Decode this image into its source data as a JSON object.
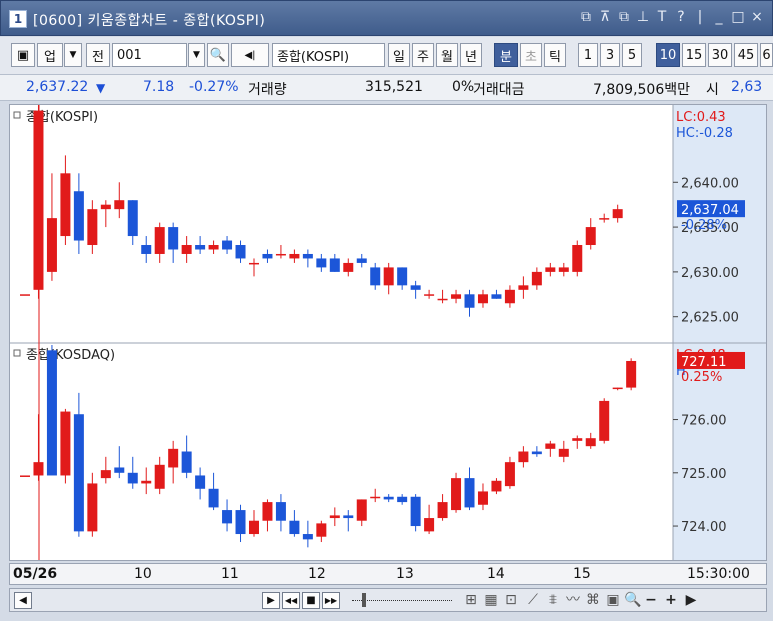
{
  "window": {
    "badge": "1",
    "title": "[0600] 키움종합차트 - 종합(KOSPI)",
    "controls": [
      "⧉",
      "⊼",
      "⧉",
      "⊥",
      "T",
      "?",
      "|",
      "_",
      "□",
      "×"
    ]
  },
  "toolbar": {
    "layout_icon": "▣",
    "market": "업",
    "prev": "전",
    "code": "001",
    "search_icon": "🔍",
    "sound_icon": "◀|",
    "stock_name": "종합(KOSPI)",
    "periods": [
      "일",
      "주",
      "월",
      "년",
      "분",
      "초",
      "틱"
    ],
    "active_period": "분",
    "intervals": [
      "1",
      "3",
      "5",
      "10",
      "15",
      "30",
      "45",
      "6"
    ],
    "active_interval": "10"
  },
  "quote": {
    "price": "2,637.22",
    "arrow": "▼",
    "change": "7.18",
    "change_pct": "-0.27%",
    "volume_label": "거래량",
    "volume": "315,521",
    "volume_pct": "0%",
    "turnover_label": "거래대금",
    "turnover": "7,809,506백만",
    "overflow_label": "시",
    "overflow_value": "2,63"
  },
  "chart_data": [
    {
      "type": "candlestick",
      "title": "종합(KOSPI)",
      "lc_label": "LC:0.43",
      "hc_label": "HC:-0.28",
      "y_ticks": [
        "2,640.00",
        "2,635.00",
        "2,630.00",
        "2,625.00"
      ],
      "y_tick_values": [
        2640,
        2635,
        2630,
        2625
      ],
      "ylim": [
        2622.4,
        2648.4
      ],
      "current_value": "2,637.04",
      "current_pct": "-0.28%",
      "candles": [
        {
          "o": 2627.5,
          "h": 2627.5,
          "l": 2627.5,
          "c": 2627.5
        },
        {
          "o": 2628.0,
          "h": 2649.0,
          "l": 2627.0,
          "c": 2648.0
        },
        {
          "o": 2630.0,
          "h": 2641.0,
          "l": 2629.0,
          "c": 2636.0
        },
        {
          "o": 2634.0,
          "h": 2643.0,
          "l": 2633.0,
          "c": 2641.0
        },
        {
          "o": 2639.0,
          "h": 2641.0,
          "l": 2632.0,
          "c": 2633.5
        },
        {
          "o": 2633.0,
          "h": 2638.0,
          "l": 2632.0,
          "c": 2637.0
        },
        {
          "o": 2637.0,
          "h": 2638.0,
          "l": 2635.0,
          "c": 2637.5
        },
        {
          "o": 2637.0,
          "h": 2640.0,
          "l": 2636.0,
          "c": 2638.0
        },
        {
          "o": 2638.0,
          "h": 2638.0,
          "l": 2633.0,
          "c": 2634.0
        },
        {
          "o": 2633.0,
          "h": 2634.0,
          "l": 2631.0,
          "c": 2632.0
        },
        {
          "o": 2632.0,
          "h": 2635.5,
          "l": 2631.0,
          "c": 2635.0
        },
        {
          "o": 2635.0,
          "h": 2635.5,
          "l": 2631.0,
          "c": 2632.5
        },
        {
          "o": 2632.0,
          "h": 2634.0,
          "l": 2631.0,
          "c": 2633.0
        },
        {
          "o": 2633.0,
          "h": 2634.0,
          "l": 2632.0,
          "c": 2632.5
        },
        {
          "o": 2632.5,
          "h": 2633.5,
          "l": 2632.0,
          "c": 2633.0
        },
        {
          "o": 2633.5,
          "h": 2634.0,
          "l": 2632.0,
          "c": 2632.5
        },
        {
          "o": 2633.0,
          "h": 2633.5,
          "l": 2631.0,
          "c": 2631.5
        },
        {
          "o": 2631.0,
          "h": 2631.5,
          "l": 2629.5,
          "c": 2631.0
        },
        {
          "o": 2632.0,
          "h": 2632.5,
          "l": 2631.0,
          "c": 2631.5
        },
        {
          "o": 2632.0,
          "h": 2633.0,
          "l": 2631.5,
          "c": 2632.0
        },
        {
          "o": 2631.5,
          "h": 2632.5,
          "l": 2631.0,
          "c": 2632.0
        },
        {
          "o": 2632.0,
          "h": 2632.5,
          "l": 2630.5,
          "c": 2631.5
        },
        {
          "o": 2631.5,
          "h": 2632.0,
          "l": 2630.0,
          "c": 2630.5
        },
        {
          "o": 2631.5,
          "h": 2632.0,
          "l": 2630.0,
          "c": 2630.0
        },
        {
          "o": 2630.0,
          "h": 2631.5,
          "l": 2629.5,
          "c": 2631.0
        },
        {
          "o": 2631.5,
          "h": 2632.0,
          "l": 2630.5,
          "c": 2631.0
        },
        {
          "o": 2630.5,
          "h": 2631.0,
          "l": 2628.0,
          "c": 2628.5
        },
        {
          "o": 2628.5,
          "h": 2631.0,
          "l": 2627.5,
          "c": 2630.5
        },
        {
          "o": 2630.5,
          "h": 2630.5,
          "l": 2628.0,
          "c": 2628.5
        },
        {
          "o": 2628.5,
          "h": 2629.0,
          "l": 2627.0,
          "c": 2628.0
        },
        {
          "o": 2627.5,
          "h": 2628.0,
          "l": 2627.0,
          "c": 2627.5
        },
        {
          "o": 2627.0,
          "h": 2628.0,
          "l": 2626.5,
          "c": 2627.0
        },
        {
          "o": 2627.0,
          "h": 2628.0,
          "l": 2626.5,
          "c": 2627.5
        },
        {
          "o": 2627.5,
          "h": 2628.0,
          "l": 2625.0,
          "c": 2626.0
        },
        {
          "o": 2626.5,
          "h": 2628.0,
          "l": 2626.0,
          "c": 2627.5
        },
        {
          "o": 2627.5,
          "h": 2628.0,
          "l": 2627.0,
          "c": 2627.0
        },
        {
          "o": 2626.5,
          "h": 2628.5,
          "l": 2626.0,
          "c": 2628.0
        },
        {
          "o": 2628.0,
          "h": 2629.5,
          "l": 2627.0,
          "c": 2628.5
        },
        {
          "o": 2628.5,
          "h": 2630.5,
          "l": 2628.0,
          "c": 2630.0
        },
        {
          "o": 2630.0,
          "h": 2631.0,
          "l": 2629.5,
          "c": 2630.5
        },
        {
          "o": 2630.0,
          "h": 2631.0,
          "l": 2629.5,
          "c": 2630.5
        },
        {
          "o": 2630.0,
          "h": 2633.5,
          "l": 2629.5,
          "c": 2633.0
        },
        {
          "o": 2633.0,
          "h": 2636.0,
          "l": 2632.5,
          "c": 2635.0
        },
        {
          "o": 2636.0,
          "h": 2636.5,
          "l": 2635.5,
          "c": 2636.0
        },
        {
          "o": 2636.0,
          "h": 2637.5,
          "l": 2635.5,
          "c": 2637.0
        }
      ]
    },
    {
      "type": "candlestick",
      "title": "종합(KOSDAQ)",
      "lc_label": "LC:0.48",
      "hc_label": "H",
      "y_ticks": [
        "726.00",
        "725.00",
        "724.00"
      ],
      "y_tick_values": [
        726,
        725,
        724
      ],
      "ylim": [
        723.4,
        727.4
      ],
      "current_value": "727.11",
      "current_pct": "0.25%",
      "candles": [
        {
          "o": 724.95,
          "h": 724.95,
          "l": 724.95,
          "c": 724.95
        },
        {
          "o": 724.95,
          "h": 726.1,
          "l": 724.85,
          "c": 725.2
        },
        {
          "o": 727.3,
          "h": 727.4,
          "l": 725.0,
          "c": 724.95
        },
        {
          "o": 724.95,
          "h": 726.2,
          "l": 724.8,
          "c": 726.15
        },
        {
          "o": 726.1,
          "h": 726.5,
          "l": 723.8,
          "c": 723.9
        },
        {
          "o": 723.9,
          "h": 725.0,
          "l": 723.8,
          "c": 724.8
        },
        {
          "o": 724.9,
          "h": 725.3,
          "l": 724.8,
          "c": 725.05
        },
        {
          "o": 725.1,
          "h": 725.5,
          "l": 724.9,
          "c": 725.0
        },
        {
          "o": 725.0,
          "h": 725.3,
          "l": 724.7,
          "c": 724.8
        },
        {
          "o": 724.8,
          "h": 725.1,
          "l": 724.6,
          "c": 724.85
        },
        {
          "o": 724.7,
          "h": 725.3,
          "l": 724.6,
          "c": 725.15
        },
        {
          "o": 725.1,
          "h": 725.6,
          "l": 724.8,
          "c": 725.45
        },
        {
          "o": 725.4,
          "h": 725.7,
          "l": 724.9,
          "c": 725.0
        },
        {
          "o": 724.95,
          "h": 725.1,
          "l": 724.5,
          "c": 724.7
        },
        {
          "o": 724.7,
          "h": 725.0,
          "l": 724.3,
          "c": 724.35
        },
        {
          "o": 724.3,
          "h": 724.5,
          "l": 723.9,
          "c": 724.05
        },
        {
          "o": 724.3,
          "h": 724.4,
          "l": 723.7,
          "c": 723.85
        },
        {
          "o": 723.85,
          "h": 724.3,
          "l": 723.8,
          "c": 724.1
        },
        {
          "o": 724.1,
          "h": 724.5,
          "l": 723.9,
          "c": 724.45
        },
        {
          "o": 724.45,
          "h": 724.6,
          "l": 723.9,
          "c": 724.1
        },
        {
          "o": 724.1,
          "h": 724.3,
          "l": 723.8,
          "c": 723.85
        },
        {
          "o": 723.85,
          "h": 724.1,
          "l": 723.6,
          "c": 723.75
        },
        {
          "o": 723.8,
          "h": 724.1,
          "l": 723.7,
          "c": 724.05
        },
        {
          "o": 724.15,
          "h": 724.35,
          "l": 724.0,
          "c": 724.2
        },
        {
          "o": 724.2,
          "h": 724.3,
          "l": 723.9,
          "c": 724.15
        },
        {
          "o": 724.1,
          "h": 724.5,
          "l": 724.0,
          "c": 724.5
        },
        {
          "o": 724.55,
          "h": 724.7,
          "l": 724.45,
          "c": 724.55
        },
        {
          "o": 724.55,
          "h": 724.6,
          "l": 724.45,
          "c": 724.5
        },
        {
          "o": 724.55,
          "h": 724.6,
          "l": 724.4,
          "c": 724.45
        },
        {
          "o": 724.55,
          "h": 724.6,
          "l": 723.9,
          "c": 724.0
        },
        {
          "o": 723.9,
          "h": 724.4,
          "l": 723.85,
          "c": 724.15
        },
        {
          "o": 724.15,
          "h": 724.6,
          "l": 724.1,
          "c": 724.45
        },
        {
          "o": 724.3,
          "h": 725.0,
          "l": 724.25,
          "c": 724.9
        },
        {
          "o": 724.9,
          "h": 725.1,
          "l": 724.3,
          "c": 724.35
        },
        {
          "o": 724.4,
          "h": 724.8,
          "l": 724.3,
          "c": 724.65
        },
        {
          "o": 724.65,
          "h": 724.9,
          "l": 724.6,
          "c": 724.85
        },
        {
          "o": 724.75,
          "h": 725.3,
          "l": 724.7,
          "c": 725.2
        },
        {
          "o": 725.2,
          "h": 725.5,
          "l": 725.1,
          "c": 725.4
        },
        {
          "o": 725.4,
          "h": 725.5,
          "l": 725.3,
          "c": 725.35
        },
        {
          "o": 725.45,
          "h": 725.6,
          "l": 725.3,
          "c": 725.55
        },
        {
          "o": 725.3,
          "h": 725.6,
          "l": 725.2,
          "c": 725.45
        },
        {
          "o": 725.6,
          "h": 725.7,
          "l": 725.45,
          "c": 725.65
        },
        {
          "o": 725.5,
          "h": 725.75,
          "l": 725.45,
          "c": 725.65
        },
        {
          "o": 725.6,
          "h": 726.4,
          "l": 725.55,
          "c": 726.35
        },
        {
          "o": 726.6,
          "h": 726.6,
          "l": 726.55,
          "c": 726.6
        },
        {
          "o": 726.6,
          "h": 727.15,
          "l": 726.55,
          "c": 727.1
        }
      ]
    }
  ],
  "dates": [
    "05/26",
    "10",
    "11",
    "12",
    "13",
    "14",
    "15"
  ],
  "end_time": "15:30:00",
  "colors": {
    "up": "#e11a1a",
    "down": "#1c56d8",
    "accent": "#3f5f9c",
    "axis_bg": "#dde8f6",
    "cursor": "#e11a1a"
  },
  "bottom": {
    "scroll_left_icon": "◀",
    "play_icon": "▶",
    "rewind_icon": "◀◀",
    "stop_icon": "■",
    "forward_icon": "▶▶",
    "zoom_in": "+",
    "zoom_out": "−",
    "search_icon": "🔍"
  }
}
